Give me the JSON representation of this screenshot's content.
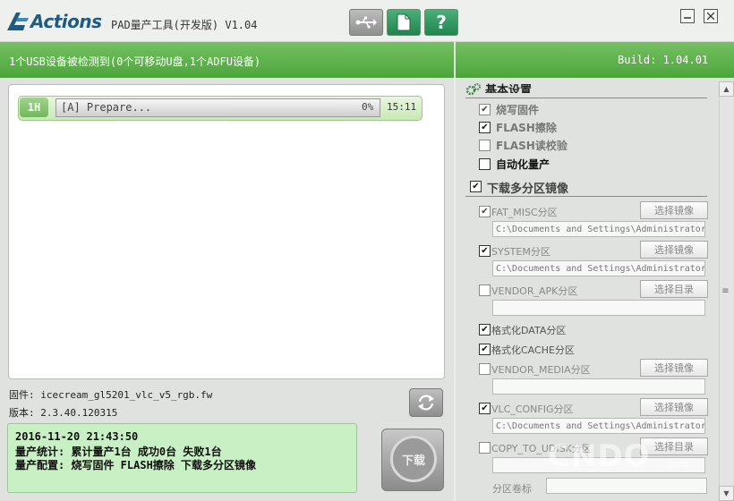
{
  "titlebar": {
    "logo_text": "Actions",
    "app_title": "PAD量产工具(开发版) V1.04",
    "help_label": "?"
  },
  "statusbar": {
    "detect_text": "1个USB设备被检测到(0个可移动U盘,1个ADFU设备)",
    "build_text": "Build: 1.04.01"
  },
  "device": {
    "port": "1H",
    "status": "[A] Prepare...",
    "progress_percent": 0,
    "progress_label": "0%",
    "elapsed": "15:11"
  },
  "info": {
    "firmware": "固件: icecream_gl5201_vlc_v5_rgb.fw",
    "version": "版本: 2.3.40.120315"
  },
  "log": {
    "line1": "2016-11-20 21:43:50",
    "line2": "量产统计: 累计量产1台 成功0台 失败1台",
    "line3": "量产配置: 烧写固件 FLASH擦除 下载多分区镜像"
  },
  "download_label": "下载",
  "settings": {
    "basic_title": "基本设置",
    "options": [
      {
        "label": "烧写固件",
        "checked": true
      },
      {
        "label": "FLASH擦除",
        "checked": true
      },
      {
        "label": "FLASH读校验",
        "checked": false
      },
      {
        "label": "自动化量产",
        "checked": false
      }
    ],
    "multi_title": "下载多分区镜像",
    "multi_checked": true,
    "partitions": [
      {
        "name": "FAT_MISC分区",
        "checked": true,
        "button": "选择镜像",
        "path": "C:\\Documents and Settings\\Administrator"
      },
      {
        "name": "SYSTEM分区",
        "checked": true,
        "button": "选择镜像",
        "path": "C:\\Documents and Settings\\Administrator"
      },
      {
        "name": "VENDOR_APK分区",
        "checked": false,
        "button": "选择目录",
        "path": ""
      },
      {
        "name": "格式化DATA分区",
        "checked": true
      },
      {
        "name": "格式化CACHE分区",
        "checked": true
      },
      {
        "name": "VENDOR_MEDIA分区",
        "checked": false,
        "button": "选择镜像",
        "path": ""
      },
      {
        "name": "VLC_CONFIG分区",
        "checked": true,
        "button": "选择镜像",
        "path": "C:\\Documents and Settings\\Administrator"
      },
      {
        "name": "COPY_TO_UDISK分区",
        "checked": false,
        "button": "选择目录",
        "path": ""
      }
    ],
    "volume_label": "分区卷标",
    "volume_value": ""
  },
  "watermark": {
    "text": "CNDO",
    "suffix": ".com"
  },
  "colors": {
    "accent_green": "#4ea53c",
    "log_bg": "#c9efc4",
    "logo_blue": "#1f5b80"
  }
}
